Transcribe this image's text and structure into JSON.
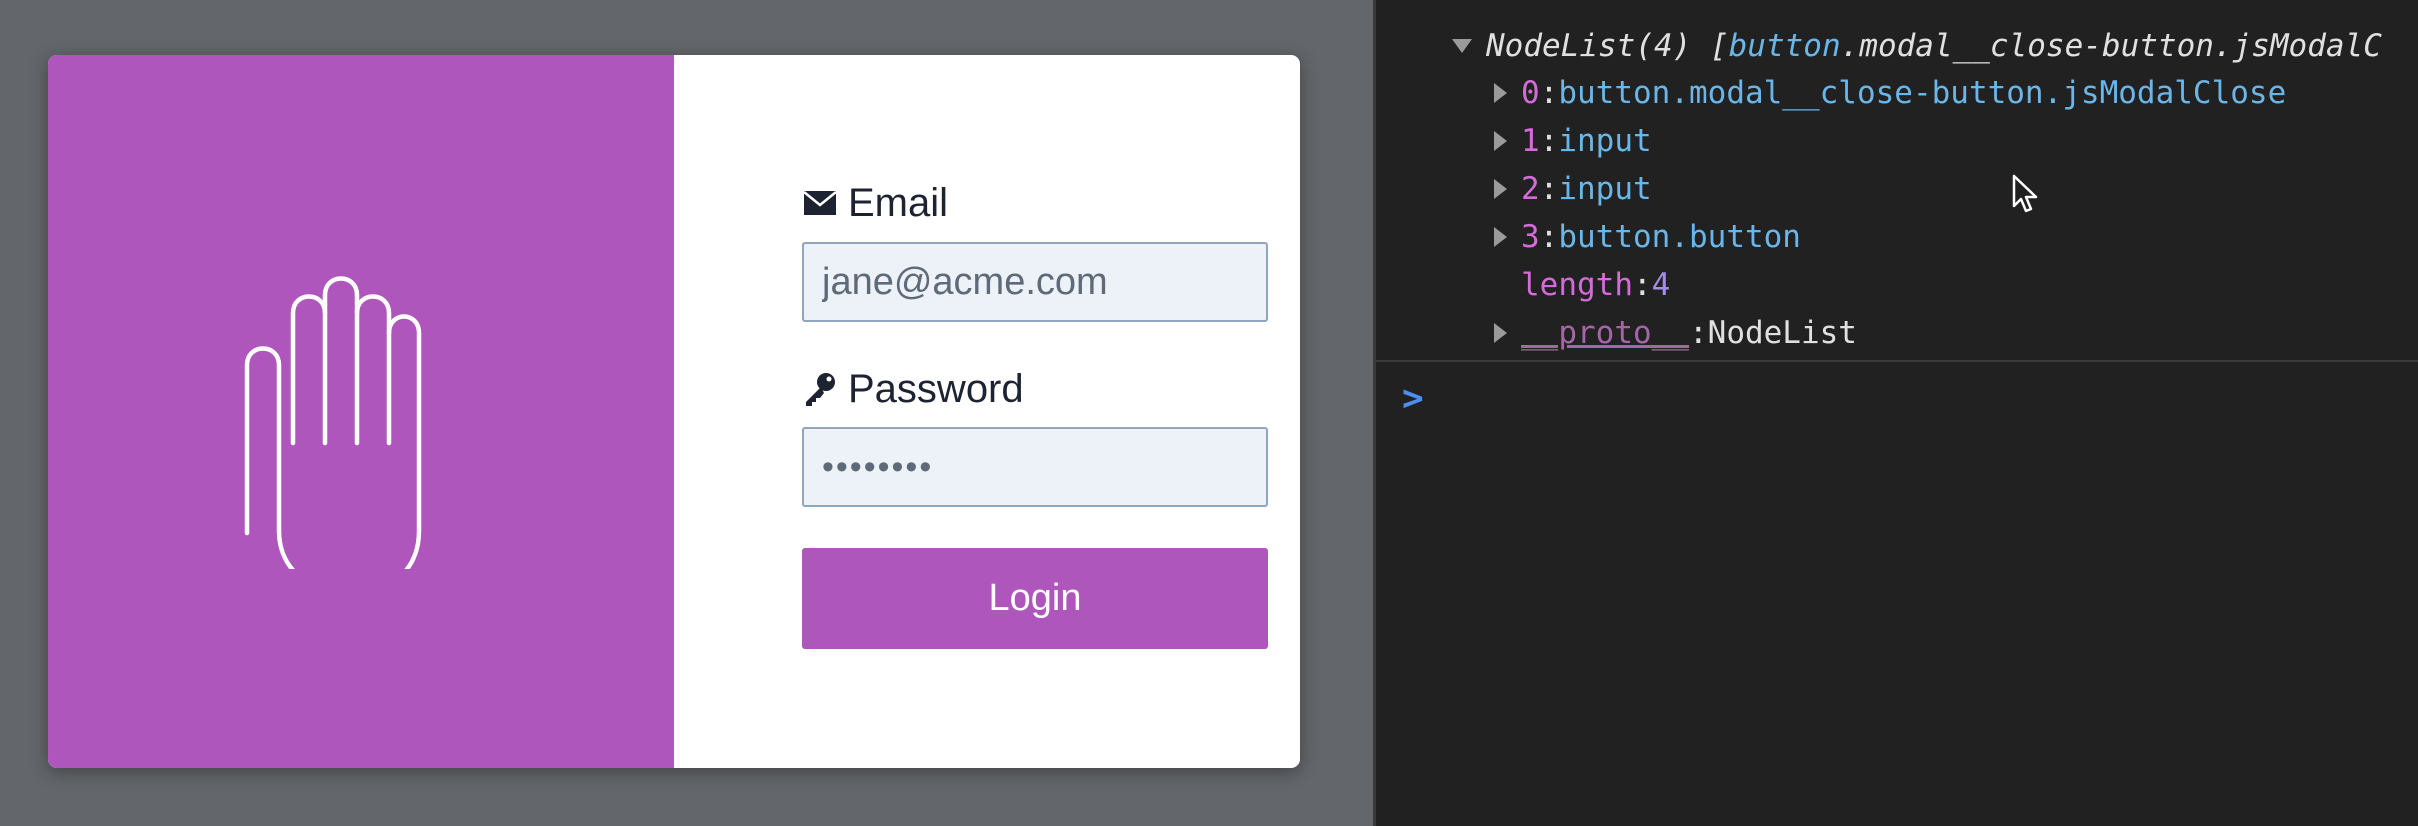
{
  "modal": {
    "hero_icon": "raised-hand-icon",
    "hero_color": "#af56bc",
    "email": {
      "icon": "envelope-icon",
      "label": "Email",
      "value": "jane@acme.com"
    },
    "password": {
      "icon": "key-icon",
      "label": "Password",
      "masked_value": "••••••••"
    },
    "login_label": "Login"
  },
  "devtools": {
    "header": {
      "prefix": "NodeList(4) [",
      "preview_class": "button",
      "preview_rest": ".modal__close-button.jsModalC"
    },
    "items": [
      {
        "index": "0",
        "sep": ": ",
        "tag": "button",
        "classes": ".modal__close-button.jsModalClose"
      },
      {
        "index": "1",
        "sep": ": ",
        "tag": "input",
        "classes": ""
      },
      {
        "index": "2",
        "sep": ": ",
        "tag": "input",
        "classes": ""
      },
      {
        "index": "3",
        "sep": ": ",
        "tag": "button",
        "classes": ".button"
      }
    ],
    "length": {
      "key": "length",
      "sep": ": ",
      "value": "4"
    },
    "proto": {
      "key": "__proto__",
      "sep": ": ",
      "value": "NodeList"
    },
    "prompt": ">",
    "accent_prompt": "#4d8ff0"
  }
}
